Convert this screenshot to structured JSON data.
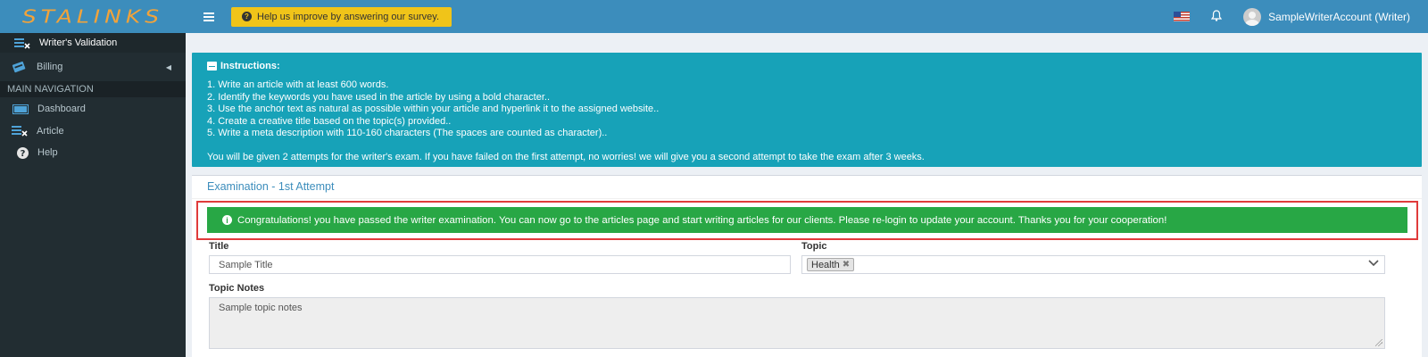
{
  "brand": {
    "logo_text": "STALINKS",
    "primary_color": "#3c8dbc",
    "logo_color": "#f2a33a"
  },
  "header": {
    "survey_label": "Help us improve by answering our survey.",
    "user_name": "SampleWriterAccount (Writer)"
  },
  "sidebar": {
    "items_top": [
      {
        "label": "Writer's Validation",
        "icon": "validation-icon"
      },
      {
        "label": "Billing",
        "icon": "billing-icon"
      }
    ],
    "section_header": "MAIN NAVIGATION",
    "items_main": [
      {
        "label": "Dashboard",
        "icon": "dashboard-icon"
      },
      {
        "label": "Article",
        "icon": "article-icon"
      },
      {
        "label": "Help",
        "icon": "help-icon"
      }
    ]
  },
  "instructions": {
    "title": "Instructions:",
    "items": [
      "1. Write an article with at least 600 words.",
      "2. Identify the keywords you have used in the article by using a bold character..",
      "3. Use the anchor text as natural as possible within your article and hyperlink it to the assigned website..",
      "4. Create a creative title based on the topic(s) provided..",
      "5. Write a meta description with 110-160 characters (The spaces are counted as character).."
    ],
    "attempts_note": "You will be given 2 attempts for the writer's exam. If you have failed on the first attempt, no worries! we will give you a second attempt to take the exam after 3 weeks.",
    "color": "#17a2b8"
  },
  "exam": {
    "title": "Examination - 1st Attempt",
    "success_message": "Congratulations! you have passed the writer examination. You can now go to the articles page and start writing articles for our clients. Please re-login to update your account. Thanks you for your cooperation!",
    "success_color": "#28a745",
    "highlight_color": "#e03b3b",
    "title_label": "Title",
    "title_value": "Sample Title",
    "topic_label": "Topic",
    "topic_tag": "Health",
    "topic_notes_label": "Topic Notes",
    "topic_notes_value": "Sample topic notes"
  }
}
